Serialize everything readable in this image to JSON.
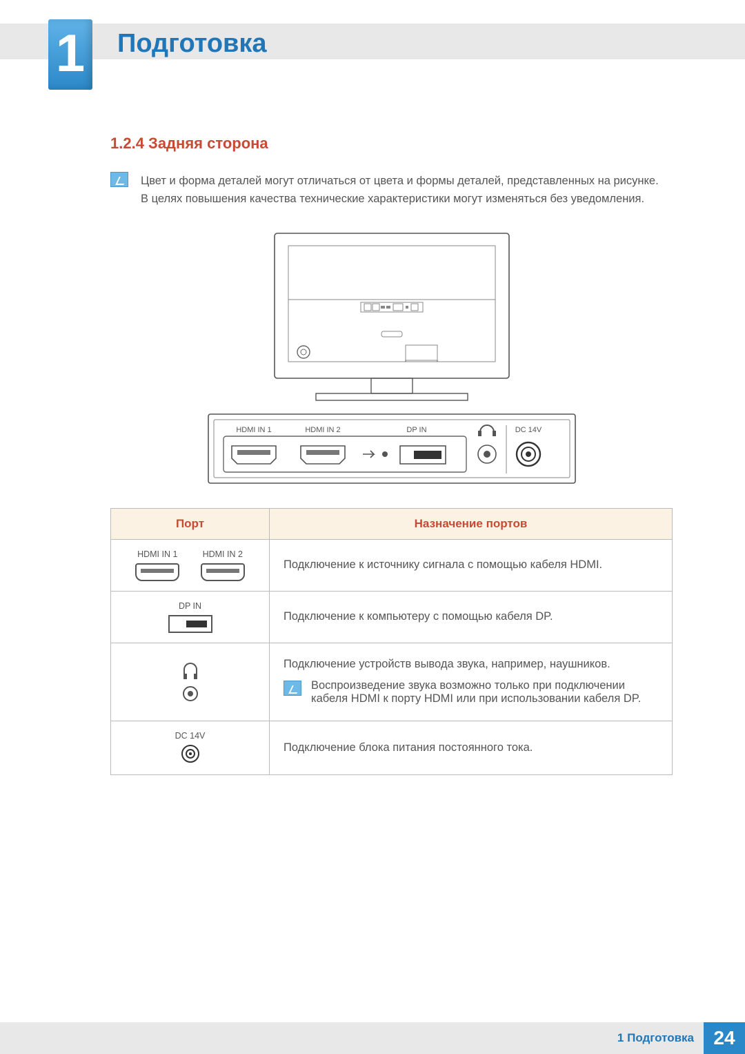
{
  "chapter": {
    "number": "1",
    "title": "Подготовка"
  },
  "section": {
    "number_title": "1.2.4 Задняя сторона"
  },
  "intro_note": {
    "line1": "Цвет и форма деталей могут отличаться от цвета и формы деталей, представленных на рисунке.",
    "line2": "В целях повышения качества технические характеристики могут изменяться без уведомления."
  },
  "panel_labels": {
    "hdmi1": "HDMI IN 1",
    "hdmi2": "HDMI IN 2",
    "dpin": "DP IN",
    "dc14v": "DC 14V"
  },
  "table": {
    "headers": {
      "port": "Порт",
      "desc": "Назначение портов"
    },
    "rows": {
      "hdmi": {
        "label1": "HDMI IN 1",
        "label2": "HDMI IN 2",
        "desc": "Подключение к источнику сигнала с помощью кабеля HDMI."
      },
      "dp": {
        "label": "DP IN",
        "desc": "Подключение к компьютеру с помощью кабеля DP."
      },
      "audio": {
        "desc": "Подключение устройств вывода звука, например, наушников.",
        "note": "Воспроизведение звука возможно только при подключении кабеля HDMI к порту HDMI или при использовании кабеля DP."
      },
      "dc": {
        "label": "DC 14V",
        "desc": "Подключение блока питания постоянного тока."
      }
    }
  },
  "footer": {
    "label": "1 Подготовка",
    "page": "24"
  }
}
